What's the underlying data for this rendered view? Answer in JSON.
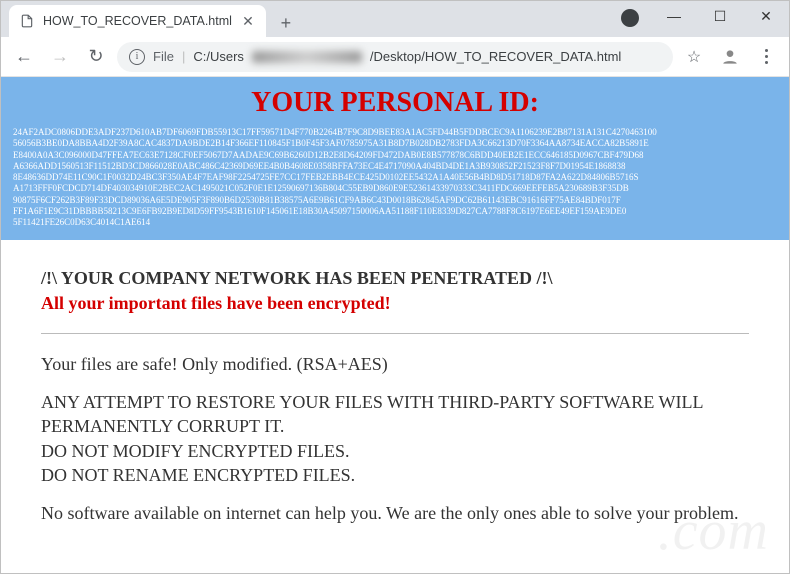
{
  "window": {
    "minimize_icon": "—",
    "maximize_icon": "☐",
    "close_icon": "✕"
  },
  "tab": {
    "title": "HOW_TO_RECOVER_DATA.html",
    "close_icon": "✕"
  },
  "new_tab_icon": "+",
  "toolbar": {
    "back_icon": "←",
    "forward_icon": "→",
    "reload_icon": "↻",
    "info_icon": "i",
    "file_label": "File",
    "url_prefix": "C:/Users",
    "url_suffix": "/Desktop/HOW_TO_RECOVER_DATA.html",
    "star_icon": "☆",
    "menu_icon": "⋮"
  },
  "ransom": {
    "header_title": "YOUR PERSONAL ID:",
    "id_block": "24AF2ADC0806DDE3ADF237D610AB7DF6069FDB55913C17FF59571D4F770B2264B7F9C8D9BEE83A1AC5FD44B5FDDBCEC9A1106239E2B87131A131C4270463100\n56056B3BE0DA8BBA4D2F39A8CAC4837DA9BDE2B14F366EF110845F1B0F45F3AF0785975A31B8D7B028DB2783FDA3C66213D70F3364AA8734EACCA82B5891E\nE8400A0A3C096000D47FFEA7EC63E7128CF0EF5067D7AADAE9C69B6260D12B2E8D64209FD472DAB0E8B577878C6BDD40EB2E1ECC646185D0967CBF479D68\nA6366ADD1560513F11512BD3CD866028E0ABC486C42369D69EE4B0B4608E0358BFFA73EC4E4717090A404BD4DE1A3B930852F21523F8F7D01954E1868838\n8E48636DD74E11C90C1F0032D24BC3F350AE4F7EAF98F2254725FE7CC17FEB2EBB4ECE425D0102EE5432A1A40E56B4BD8D51718D87FA2A622D84806B5716S\nA1713FFF0FCDCD714DF403034910E2BEC2AC1495021C052F0E1E12590697136B804C55EB9D860E9E52361433970333C3411FDC669EEFEB5A230689B3F35DB\n90875F6CF262B3F89F33DCD89036A6E5DE905F3F890B6D2530B81B38575A6E9B61CF9AB6C43D0018B62845AF9DC62B61143EBC91616FF75AE84BDF017F\nFF1A6F1E9C31DBBBB58213C9E6FB92B9ED8D59FF9543B1610F145061E18B30A45097150006AA51188F110E8339D827CA7788F8C6197E6EE49EF159AE9DE0\n5F11421FE26C0D63C4014C1AE614",
    "line1": "/!\\ YOUR COMPANY NETWORK HAS BEEN PENETRATED /!\\",
    "line2": "All your important files have been encrypted!",
    "para_safe": "Your files are safe! Only modified. (RSA+AES)",
    "para_warn1": "ANY ATTEMPT TO RESTORE YOUR FILES WITH THIRD-PARTY SOFTWARE WILL PERMANENTLY CORRUPT IT.",
    "para_warn2": "DO NOT MODIFY ENCRYPTED FILES.",
    "para_warn3": "DO NOT RENAME ENCRYPTED FILES.",
    "para_nosoft": "No software available on internet can help you. We are the only ones able to solve your problem."
  },
  "watermark": ".com"
}
